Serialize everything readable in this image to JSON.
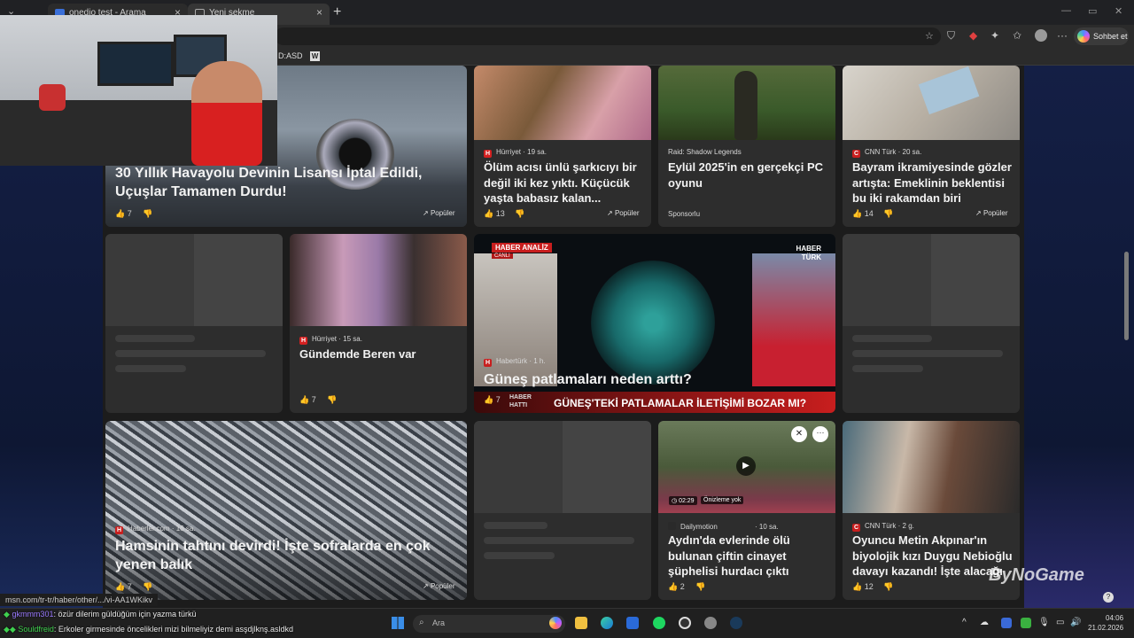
{
  "browser": {
    "tabs": [
      {
        "label": "onedio test - Arama"
      },
      {
        "label": "Yeni sekme"
      }
    ],
    "new_tab": "+",
    "favorites": [
      {
        "label": "D:ASD"
      }
    ],
    "chat_button": "Sohbet et"
  },
  "feed": {
    "cards": [
      {
        "source": "",
        "time": "",
        "title": "30 Yıllık Havayolu Devinin Lisansı İptal Edildi, Uçuşlar Tamamen Durdu!",
        "likes": "7",
        "badge": "Popüler"
      },
      {
        "source": "Hürriyet",
        "time": "· 19 sa.",
        "title": "Ölüm acısı ünlü şarkıcıyı bir değil iki kez yıktı. Küçücük yaşta babasız kalan...",
        "likes": "13",
        "badge": "Popüler"
      },
      {
        "source": "Raid: Shadow Legends",
        "time": "",
        "title": "Eylül 2025'in en gerçekçi PC oyunu",
        "sponsor": "Sponsorlu"
      },
      {
        "source": "CNN Türk",
        "time": "· 20 sa.",
        "title": "Bayram ikramiyesinde gözler artışta: Emeklinin beklentisi bu iki rakamdan biri",
        "likes": "14",
        "badge": "Popüler"
      },
      {
        "source": "Hürriyet",
        "time": "· 15 sa.",
        "title": "Gündemde Beren var",
        "likes": "7"
      },
      {
        "source": "Habertürk",
        "time": "· 1 h.",
        "title": "Güneş patlamaları neden arttı?",
        "likes": "7",
        "overlay_label": "HABER ANALİZ",
        "overlay_live": "CANLI",
        "overlay_brand": "HABER TÜRK",
        "overlay_ticker": "GÜNEŞ'TEKİ PATLAMALAR İLETİŞİMİ BOZAR MI?",
        "overlay_corner": "HABER HATTI"
      },
      {
        "source": "Haberler.com",
        "time": "· 16 sa.",
        "title": "Hamsinin tahtını devirdi! İşte sofralarda en çok yenen balık",
        "likes": "7",
        "badge": "Popüler"
      },
      {
        "source": "Dailymotion",
        "time": "· 10 sa.",
        "title": "Aydın'da evlerinde ölü bulunan çiftin cinayet şüphelisi hurdacı çıktı",
        "likes": "2",
        "duration": "02:29",
        "preview": "Önizleme yok"
      },
      {
        "source": "CNN Türk",
        "time": "· 2 g.",
        "title": "Oyuncu Metin Akpınar'ın biyolojik kızı Duygu Nebioğlu davayı kazandı! İşte alacağı",
        "likes": "12"
      }
    ]
  },
  "status_url": "msn.com/tr-tr/haber/other/.../vi-AA1WKikv",
  "stream_chat": [
    {
      "user": "gkmmm301",
      "message": ": özür dilerim güldüğüm için yazma türkü",
      "user_color": "#9b7bff"
    },
    {
      "user": "Souldfreid",
      "message": ": Erkoler girmesinde öncelikleri mizi bilmeliyiz demi asşdjlknş.asldkd",
      "user_color": "#3fd14f"
    }
  ],
  "watermark": "ByNoGame",
  "taskbar": {
    "search_placeholder": "Ara",
    "time": "04:06",
    "date": "21.02.2026"
  }
}
